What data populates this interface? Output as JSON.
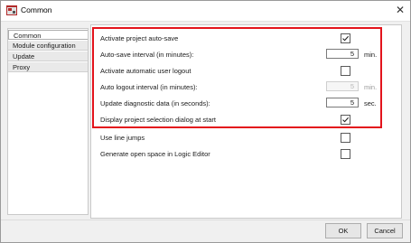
{
  "window": {
    "title": "Common",
    "close_glyph": "✕"
  },
  "nav": {
    "items": [
      {
        "label": "Common",
        "selected": true
      },
      {
        "label": "Module configuration",
        "selected": false
      },
      {
        "label": "Update",
        "selected": false
      },
      {
        "label": "Proxy",
        "selected": false
      }
    ]
  },
  "settings": {
    "auto_save": {
      "label": "Activate project auto-save",
      "checked": true
    },
    "auto_save_interval": {
      "label": "Auto-save interval (in minutes):",
      "value": "5",
      "unit": "min."
    },
    "auto_logout": {
      "label": "Activate automatic user logout",
      "checked": false
    },
    "logout_interval": {
      "label": "Auto logout interval (in minutes):",
      "value": "5",
      "unit": "min.",
      "disabled": true
    },
    "diagnostic_update": {
      "label": "Update diagnostic data (in seconds):",
      "value": "5",
      "unit": "sec."
    },
    "project_dialog": {
      "label": "Display project selection dialog at start",
      "checked": true
    },
    "line_jumps": {
      "label": "Use line jumps",
      "checked": false
    },
    "open_space": {
      "label": "Generate open space in Logic Editor",
      "checked": false
    }
  },
  "buttons": {
    "ok": "OK",
    "cancel": "Cancel"
  },
  "colors": {
    "highlight": "#e3141c"
  },
  "icons": {
    "app": "app-window-icon",
    "check": "checkmark-icon"
  }
}
